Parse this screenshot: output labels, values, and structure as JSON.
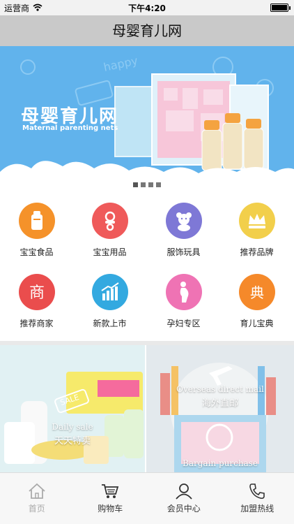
{
  "status_bar": {
    "carrier": "运营商",
    "time": "下午4:20"
  },
  "header": {
    "title": "母婴育儿网"
  },
  "banner": {
    "brand_cn": "母婴育儿网",
    "brand_en": "Maternal parenting nets",
    "slides": 4,
    "active_slide": 1
  },
  "categories": [
    {
      "label": "宝宝食品",
      "icon": "milk-bottle-icon",
      "color": "#f5922a"
    },
    {
      "label": "宝宝用品",
      "icon": "pacifier-icon",
      "color": "#ef5a5a"
    },
    {
      "label": "服饰玩具",
      "icon": "teddy-bear-icon",
      "color": "#7e78d6"
    },
    {
      "label": "推荐品牌",
      "icon": "crown-icon",
      "color": "#f2cf4b"
    },
    {
      "label": "推荐商家",
      "icon": "shop-icon",
      "color": "#ea4d4d"
    },
    {
      "label": "新款上市",
      "icon": "chart-up-icon",
      "color": "#33a9e0"
    },
    {
      "label": "孕妇专区",
      "icon": "pregnant-icon",
      "color": "#ef73b4"
    },
    {
      "label": "育儿宝典",
      "icon": "book-icon",
      "color": "#f5892a"
    }
  ],
  "promos": [
    {
      "en": "Daily sale",
      "cn": "天天特卖",
      "badge": "SALE"
    },
    {
      "en": "Overseas direct mail",
      "cn": "海外直邮",
      "extra_en": "Bargain purchase"
    }
  ],
  "tabs": [
    {
      "label": "首页",
      "icon": "home-icon",
      "active": true
    },
    {
      "label": "购物车",
      "icon": "cart-icon",
      "active": false
    },
    {
      "label": "会员中心",
      "icon": "user-icon",
      "active": false
    },
    {
      "label": "加盟热线",
      "icon": "phone-icon",
      "active": false
    }
  ],
  "colors": {
    "banner_bg": "#61b3ec",
    "title_bar": "#c9c9c9",
    "tab_active": "#aaaaaa"
  }
}
